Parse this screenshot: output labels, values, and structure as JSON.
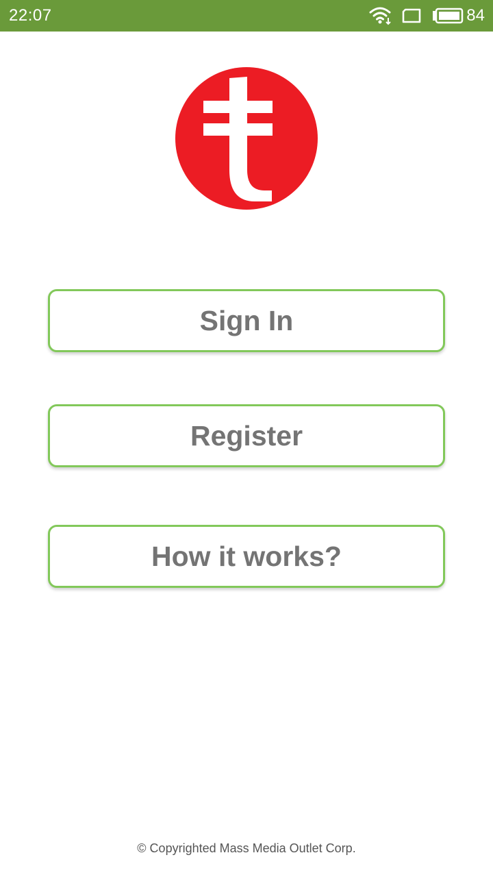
{
  "status_bar": {
    "time": "22:07",
    "battery_percent": "84",
    "background_color": "#6a9a3a",
    "icons": [
      "wifi-icon",
      "screen-rotation-icon",
      "battery-icon"
    ]
  },
  "logo": {
    "icon": "t-logo-icon",
    "color": "#ec1c24"
  },
  "buttons": {
    "sign_in": "Sign In",
    "register": "Register",
    "how_it_works": "How it works?",
    "border_color": "#82c85a",
    "text_color": "#747474"
  },
  "footer": {
    "copyright": "© Copyrighted Mass Media Outlet Corp."
  }
}
